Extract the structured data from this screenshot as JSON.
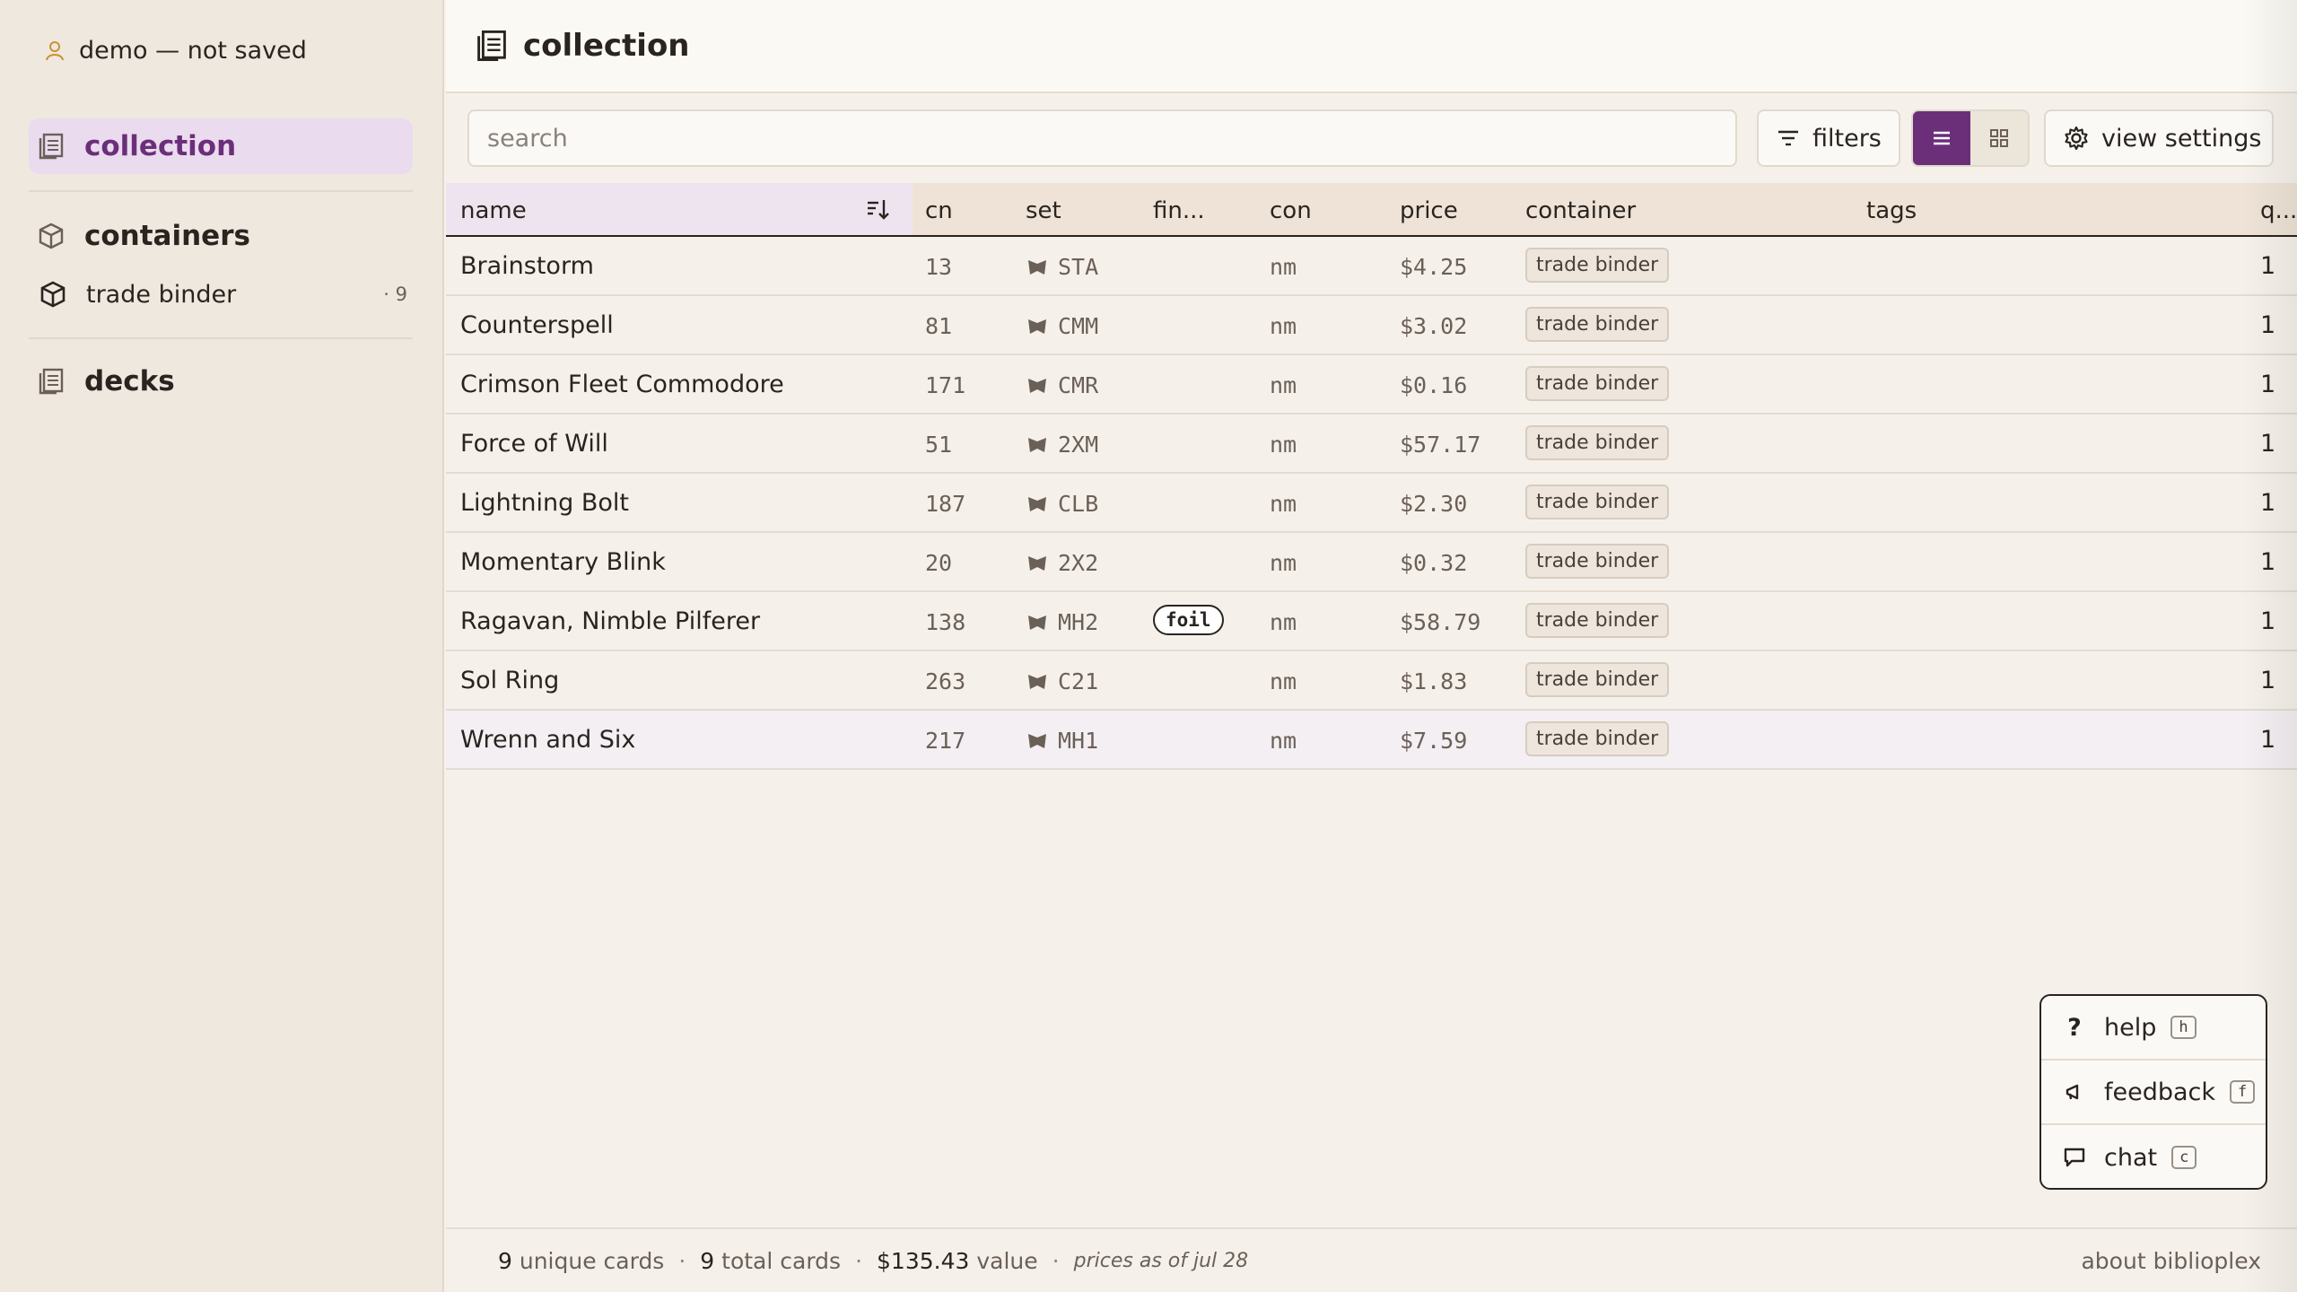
{
  "sidebar": {
    "user": "demo — not saved",
    "collection_label": "collection",
    "containers_label": "containers",
    "containers": [
      {
        "label": "trade binder",
        "count": "· 9"
      }
    ],
    "decks_label": "decks"
  },
  "header": {
    "title": "collection"
  },
  "toolbar": {
    "search_placeholder": "search",
    "filters_label": "filters",
    "view_settings_label": "view settings",
    "active_view": "list"
  },
  "table": {
    "columns": [
      "name",
      "cn",
      "set",
      "fin...",
      "con",
      "price",
      "container",
      "tags",
      "q..."
    ],
    "rows": [
      {
        "name": "Brainstorm",
        "cn": "13",
        "set": "STA",
        "finish": "",
        "con": "nm",
        "price": "$4.25",
        "container": "trade binder",
        "tags": "",
        "qty": "1"
      },
      {
        "name": "Counterspell",
        "cn": "81",
        "set": "CMM",
        "finish": "",
        "con": "nm",
        "price": "$3.02",
        "container": "trade binder",
        "tags": "",
        "qty": "1"
      },
      {
        "name": "Crimson Fleet Commodore",
        "cn": "171",
        "set": "CMR",
        "finish": "",
        "con": "nm",
        "price": "$0.16",
        "container": "trade binder",
        "tags": "",
        "qty": "1"
      },
      {
        "name": "Force of Will",
        "cn": "51",
        "set": "2XM",
        "finish": "",
        "con": "nm",
        "price": "$57.17",
        "container": "trade binder",
        "tags": "",
        "qty": "1"
      },
      {
        "name": "Lightning Bolt",
        "cn": "187",
        "set": "CLB",
        "finish": "",
        "con": "nm",
        "price": "$2.30",
        "container": "trade binder",
        "tags": "",
        "qty": "1"
      },
      {
        "name": "Momentary Blink",
        "cn": "20",
        "set": "2X2",
        "finish": "",
        "con": "nm",
        "price": "$0.32",
        "container": "trade binder",
        "tags": "",
        "qty": "1"
      },
      {
        "name": "Ragavan, Nimble Pilferer",
        "cn": "138",
        "set": "MH2",
        "finish": "foil",
        "con": "nm",
        "price": "$58.79",
        "container": "trade binder",
        "tags": "",
        "qty": "1"
      },
      {
        "name": "Sol Ring",
        "cn": "263",
        "set": "C21",
        "finish": "",
        "con": "nm",
        "price": "$1.83",
        "container": "trade binder",
        "tags": "",
        "qty": "1"
      },
      {
        "name": "Wrenn and Six",
        "cn": "217",
        "set": "MH1",
        "finish": "",
        "con": "nm",
        "price": "$7.59",
        "container": "trade binder",
        "tags": "",
        "qty": "1"
      }
    ]
  },
  "footer": {
    "unique_count": "9",
    "unique_label": "unique cards",
    "total_count": "9",
    "total_label": "total cards",
    "value": "$135.43",
    "value_label": "value",
    "sep": "·",
    "prices_as_of": "prices as of jul 28",
    "about": "about biblioplex"
  },
  "help_menu": {
    "items": [
      {
        "label": "help",
        "key": "h"
      },
      {
        "label": "feedback",
        "key": "f"
      },
      {
        "label": "chat",
        "key": "c"
      }
    ]
  },
  "colors": {
    "accent": "#6b2f7a",
    "sidebar_bg": "#efe8df",
    "page_bg": "#f5f1ea"
  }
}
